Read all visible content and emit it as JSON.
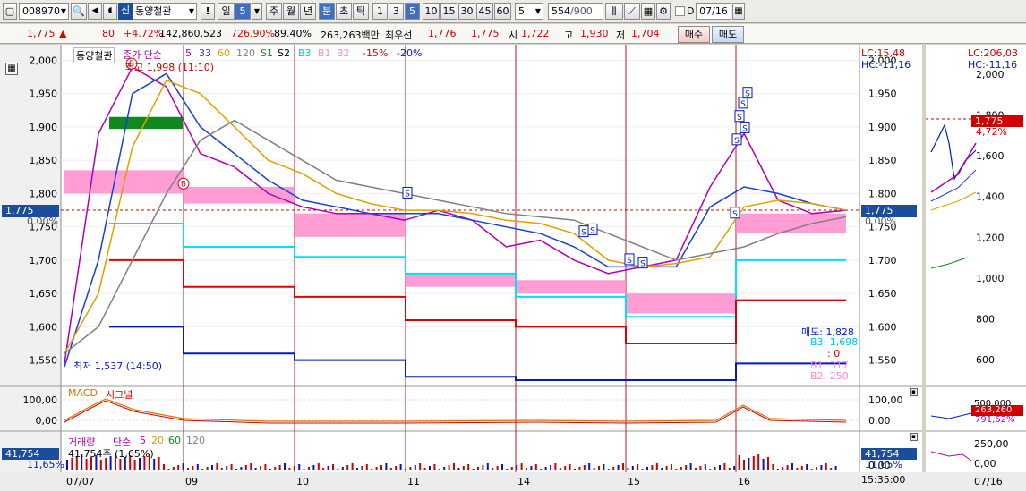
{
  "toolbar": {
    "stock_code": "008970",
    "stock_badge": "신",
    "stock_name": "동양철관",
    "period_day": "일",
    "period_value": "5",
    "btn_week": "주",
    "btn_month": "월",
    "btn_year": "년",
    "btn_minute": "분",
    "btn_second": "초",
    "btn_tick": "틱",
    "intervals": [
      "1",
      "3",
      "5",
      "10",
      "15",
      "30",
      "45",
      "60"
    ],
    "selected_interval": "5",
    "count_value": "5",
    "data_count": "554",
    "data_total": "/900",
    "date_checkbox_label": "D",
    "date_value": "07/16"
  },
  "quote": {
    "price": "1,775",
    "change": "80",
    "change_pct": "+4.72%",
    "volume": "142,860,523",
    "volume_ratio": "726.90%",
    "ratio2": "89.40%",
    "amount": "263,263백만",
    "best_label": "최우선",
    "ask": "1,776",
    "bid": "1,775",
    "open_label": "시",
    "open": "1,722",
    "high_label": "고",
    "high": "1,930",
    "low_label": "저",
    "low": "1,704",
    "buy_btn": "매수",
    "sell_btn": "매도"
  },
  "chart": {
    "legend_name": "동양철관",
    "legend_ma_prefix": "종가 단순",
    "legend_ma": [
      "5",
      "33",
      "60",
      "120"
    ],
    "legend_s1": "S1",
    "legend_s2": "S2",
    "legend_b3": "B3",
    "legend_b1": "B1",
    "legend_b2": "B2",
    "legend_pct1": "-15%",
    "legend_pct2": "-20%",
    "high_note": "최고 1,998 (11:10)",
    "low_note": "최저 1,537 (14:50)",
    "lc": "LC:15,48",
    "hc": "HC:-11,16",
    "current_price_tag": "1,775",
    "zero_pct": "0.00%",
    "sell_label": "매도: 1,828",
    "b3_label": "B3: 1,698",
    "colon_zero": ": 0",
    "b1_label": "B1: 317",
    "b2_label": "B2: 250",
    "right_lc": "LC:206,03",
    "right_hc": "HC:-11,16",
    "right_price_tag": "1,775",
    "right_pct": "4,72%",
    "macd_label": "MACD",
    "signal_label": "시그널",
    "vol_label": "거래량",
    "vol_ma_prefix": "단순",
    "vol_ma": [
      "5",
      "20",
      "60",
      "120"
    ],
    "vol_value_note": "41,754주 (1,65%)",
    "vol_tag": "41,754",
    "vol_pct_tag": "11,65%",
    "right_macd_tag": "263,260",
    "right_macd_pct": "791,62%",
    "time_label": "15:35:00",
    "right_date": "07/16",
    "colors": {
      "ma5": "#b000b0",
      "ma33": "#1a3fd6",
      "ma60": "#e0a000",
      "ma120": "#808080",
      "cyan": "#00e0ff",
      "pink": "#ff8ccc",
      "red": "#e00000",
      "navy": "#0018c8",
      "green_box": "#108a20"
    }
  },
  "chart_data": {
    "type": "line",
    "title": "동양철관",
    "ylim": [
      1520,
      2010
    ],
    "y_ticks": [
      "2,000",
      "1,950",
      "1,900",
      "1,850",
      "1,800",
      "1,750",
      "1,700",
      "1,650",
      "1,600",
      "1,550"
    ],
    "right_y_ticks": [
      "2,000",
      "1,800",
      "1,600",
      "1,400",
      "1,200",
      "1,000",
      "800",
      "600"
    ],
    "x_ticks": [
      "07/07",
      "09",
      "10",
      "11",
      "14",
      "15",
      "16"
    ],
    "macd_y_ticks": [
      "100,00",
      "0,00"
    ],
    "vol_y_ticks": [
      "0,00"
    ],
    "right_vol_ticks": [
      "250,00",
      "0,00"
    ],
    "right_macd_ticks": [
      "500,000"
    ],
    "series": [
      {
        "name": "5",
        "values": [
          1545,
          1890,
          1990,
          1960,
          1860,
          1840,
          1800,
          1780,
          1770,
          1770,
          1760,
          1775,
          1760,
          1720,
          1730,
          1700,
          1680,
          1690,
          1700,
          1810,
          1890,
          1790,
          1770,
          1775
        ]
      },
      {
        "name": "33",
        "values": [
          1540,
          1700,
          1950,
          1980,
          1900,
          1860,
          1820,
          1790,
          1780,
          1770,
          1770,
          1770,
          1760,
          1750,
          1740,
          1720,
          1690,
          1690,
          1690,
          1780,
          1810,
          1800,
          1785,
          1775
        ]
      },
      {
        "name": "60",
        "values": [
          1560,
          1650,
          1870,
          1970,
          1950,
          1900,
          1850,
          1830,
          1800,
          1785,
          1775,
          1775,
          1770,
          1760,
          1755,
          1740,
          1700,
          1690,
          1695,
          1705,
          1780,
          1790,
          1785,
          1775
        ]
      },
      {
        "name": "120",
        "values": [
          1560,
          1600,
          1700,
          1800,
          1880,
          1910,
          1880,
          1850,
          1820,
          1810,
          1800,
          1790,
          1780,
          1770,
          1765,
          1760,
          1740,
          1720,
          1700,
          1710,
          1720,
          1740,
          1755,
          1765
        ]
      }
    ]
  }
}
